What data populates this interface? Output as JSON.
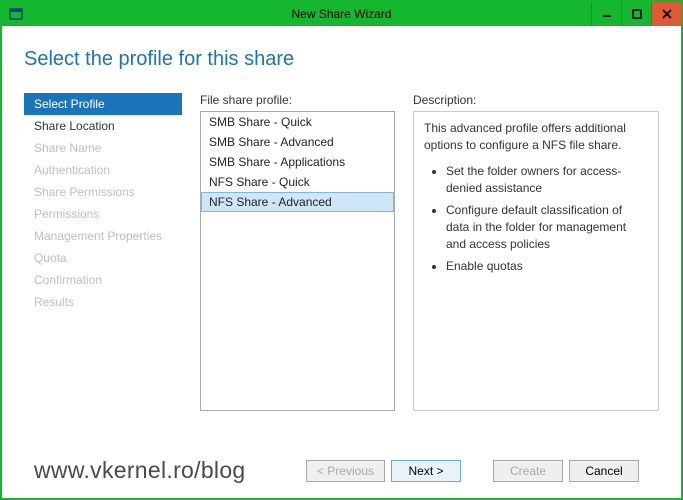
{
  "window": {
    "title": "New Share Wizard"
  },
  "heading": "Select the profile for this share",
  "sidebar": {
    "items": [
      {
        "label": "Select Profile",
        "enabled": true,
        "selected": true
      },
      {
        "label": "Share Location",
        "enabled": true,
        "selected": false
      },
      {
        "label": "Share Name",
        "enabled": false,
        "selected": false
      },
      {
        "label": "Authentication",
        "enabled": false,
        "selected": false
      },
      {
        "label": "Share Permissions",
        "enabled": false,
        "selected": false
      },
      {
        "label": "Permissions",
        "enabled": false,
        "selected": false
      },
      {
        "label": "Management Properties",
        "enabled": false,
        "selected": false
      },
      {
        "label": "Quota",
        "enabled": false,
        "selected": false
      },
      {
        "label": "Confirmation",
        "enabled": false,
        "selected": false
      },
      {
        "label": "Results",
        "enabled": false,
        "selected": false
      }
    ]
  },
  "profiles": {
    "label": "File share profile:",
    "items": [
      {
        "label": "SMB Share - Quick",
        "selected": false
      },
      {
        "label": "SMB Share - Advanced",
        "selected": false
      },
      {
        "label": "SMB Share - Applications",
        "selected": false
      },
      {
        "label": "NFS Share - Quick",
        "selected": false
      },
      {
        "label": "NFS Share - Advanced",
        "selected": true
      }
    ]
  },
  "description": {
    "label": "Description:",
    "intro": "This advanced profile offers additional options to configure a NFS file share.",
    "bullets": [
      "Set the folder owners for access-denied assistance",
      "Configure default classification of data in the folder for management and access policies",
      "Enable quotas"
    ]
  },
  "buttons": {
    "previous": "< Previous",
    "next": "Next >",
    "create": "Create",
    "cancel": "Cancel"
  },
  "watermark": "www.vkernel.ro/blog"
}
